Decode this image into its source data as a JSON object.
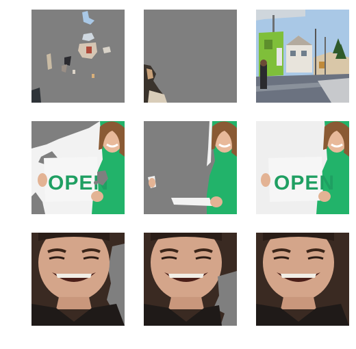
{
  "figure": {
    "rows": [
      {
        "row_id": "street",
        "panels": [
          {
            "variant": "masked-sparse",
            "subject": "street-scene"
          },
          {
            "variant": "masked-heavy",
            "subject": "street-scene"
          },
          {
            "variant": "original",
            "subject": "street-scene"
          }
        ]
      },
      {
        "row_id": "open-sign",
        "panels": [
          {
            "variant": "masked-partial",
            "subject": "woman-holding-sign",
            "sign_text": "OPEN"
          },
          {
            "variant": "masked-heavy",
            "subject": "woman-holding-sign",
            "sign_text": ""
          },
          {
            "variant": "original",
            "subject": "woman-holding-sign",
            "sign_text": "OPEN"
          }
        ]
      },
      {
        "row_id": "boy",
        "panels": [
          {
            "variant": "masked-edge",
            "subject": "smiling-boy"
          },
          {
            "variant": "masked-corner",
            "subject": "smiling-boy"
          },
          {
            "variant": "original",
            "subject": "smiling-boy"
          }
        ]
      }
    ]
  },
  "colors": {
    "mask_gray": "#7f7f7f",
    "shirt_green": "#22b36a",
    "sign_text_green": "#1f9f62",
    "sky_blue": "#a9c8e6",
    "dark_background": "#3a2a22"
  }
}
